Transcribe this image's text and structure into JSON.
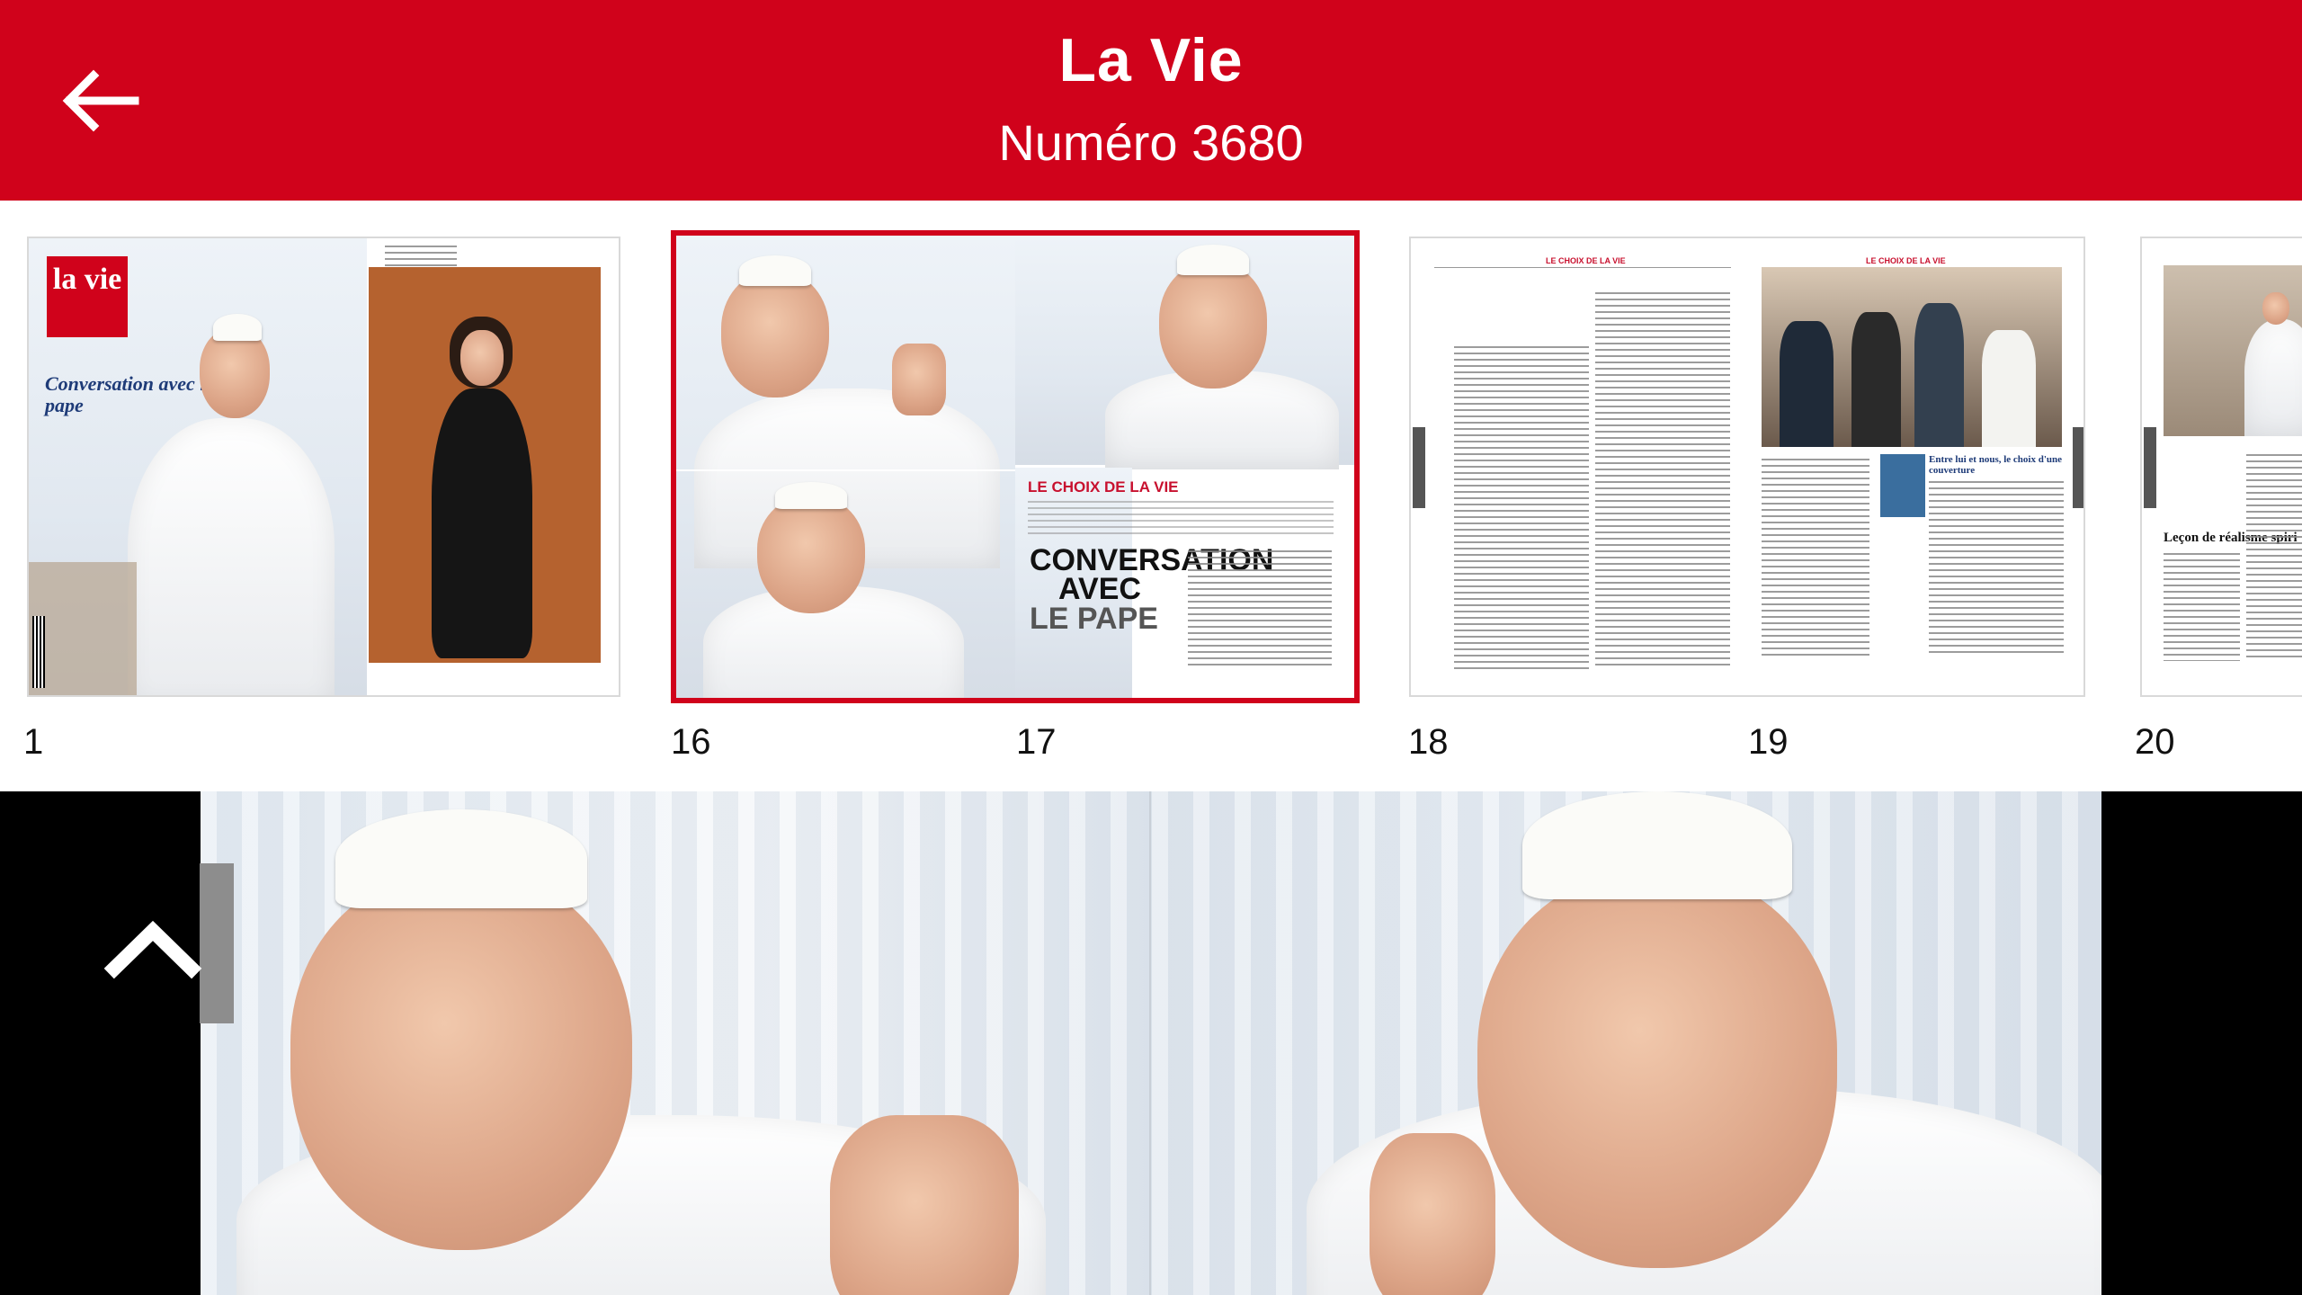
{
  "header": {
    "title": "La Vie",
    "subtitle": "Numéro 3680",
    "back_icon": "arrow-left-icon",
    "background_color": "#d0021b"
  },
  "thumbnails": [
    {
      "pages": [
        "1"
      ],
      "selected": false,
      "cover": {
        "logo": "la vie",
        "headline": "Conversation avec le pape"
      }
    },
    {
      "pages": [
        "16",
        "17"
      ],
      "selected": true,
      "spread": {
        "kicker": "LE CHOIX DE LA VIE",
        "headline_lines": [
          "CONVERSATION",
          "AVEC",
          "LE PAPE"
        ]
      }
    },
    {
      "pages": [
        "18",
        "19"
      ],
      "selected": false,
      "spread": {
        "kicker": "LE CHOIX DE LA VIE",
        "side_title": "Entre lui et nous, le choix d'une couverture"
      }
    },
    {
      "pages": [
        "20"
      ],
      "selected": false,
      "spread": {
        "headline": "Leçon de réalisme spiri"
      }
    }
  ],
  "viewer": {
    "collapse_icon": "chevron-up-icon"
  },
  "colors": {
    "accent": "#d0021b",
    "selection_border": "#d0021b"
  }
}
